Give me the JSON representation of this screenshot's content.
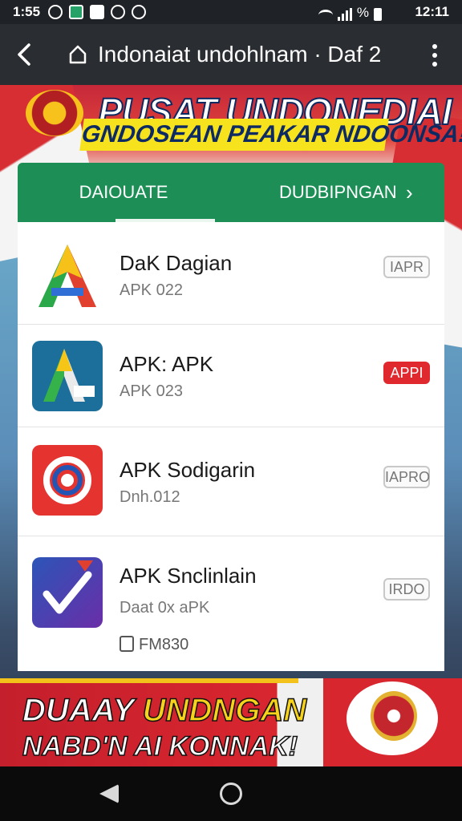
{
  "status_bar": {
    "time": "1:55",
    "battery_text": "%",
    "clock_right": "12:11"
  },
  "header": {
    "title": "Indonaiat undohlnam · Daf 2",
    "back_icon": "chevron-left-icon",
    "home_icon": "home-icon",
    "menu_icon": "more-vertical-icon"
  },
  "banner": {
    "title": "PUSAT UNDONEDIAI",
    "subtitle": "GNDOSEAN PEAKAR NDOONSA!"
  },
  "tabs": [
    {
      "label": "DAIOUATE",
      "active": true
    },
    {
      "label": "DUDBIPNGAN",
      "active": false
    }
  ],
  "tab_chevron": "›",
  "apps": [
    {
      "name": "DaK Dagian",
      "sub": "APK 022",
      "badge": "IAPR",
      "badge_style": "outline",
      "icon": "a-triangle-icon"
    },
    {
      "name": "APK: APK",
      "sub": "APK 023",
      "badge": "APPI",
      "badge_style": "red",
      "icon": "a-cart-icon"
    },
    {
      "name": "APK Sodigarin",
      "sub": "Dnh.012",
      "badge": "IAPRO",
      "badge_style": "outline",
      "icon": "circle-swirl-icon"
    },
    {
      "name": "APK Snclinlain",
      "sub": "Daat 0x aPK",
      "badge": "IRDO",
      "badge_style": "outline",
      "icon": "check-b-icon",
      "meta": "FM830"
    }
  ],
  "promo": {
    "line1_a": "DUAAY",
    "line1_b": "UNDNGAN",
    "line2": "NABD'N AI KONNAK!"
  },
  "colors": {
    "accent_green": "#1d8f56",
    "badge_red": "#e0292e",
    "banner_yellow": "#f6e21d"
  }
}
